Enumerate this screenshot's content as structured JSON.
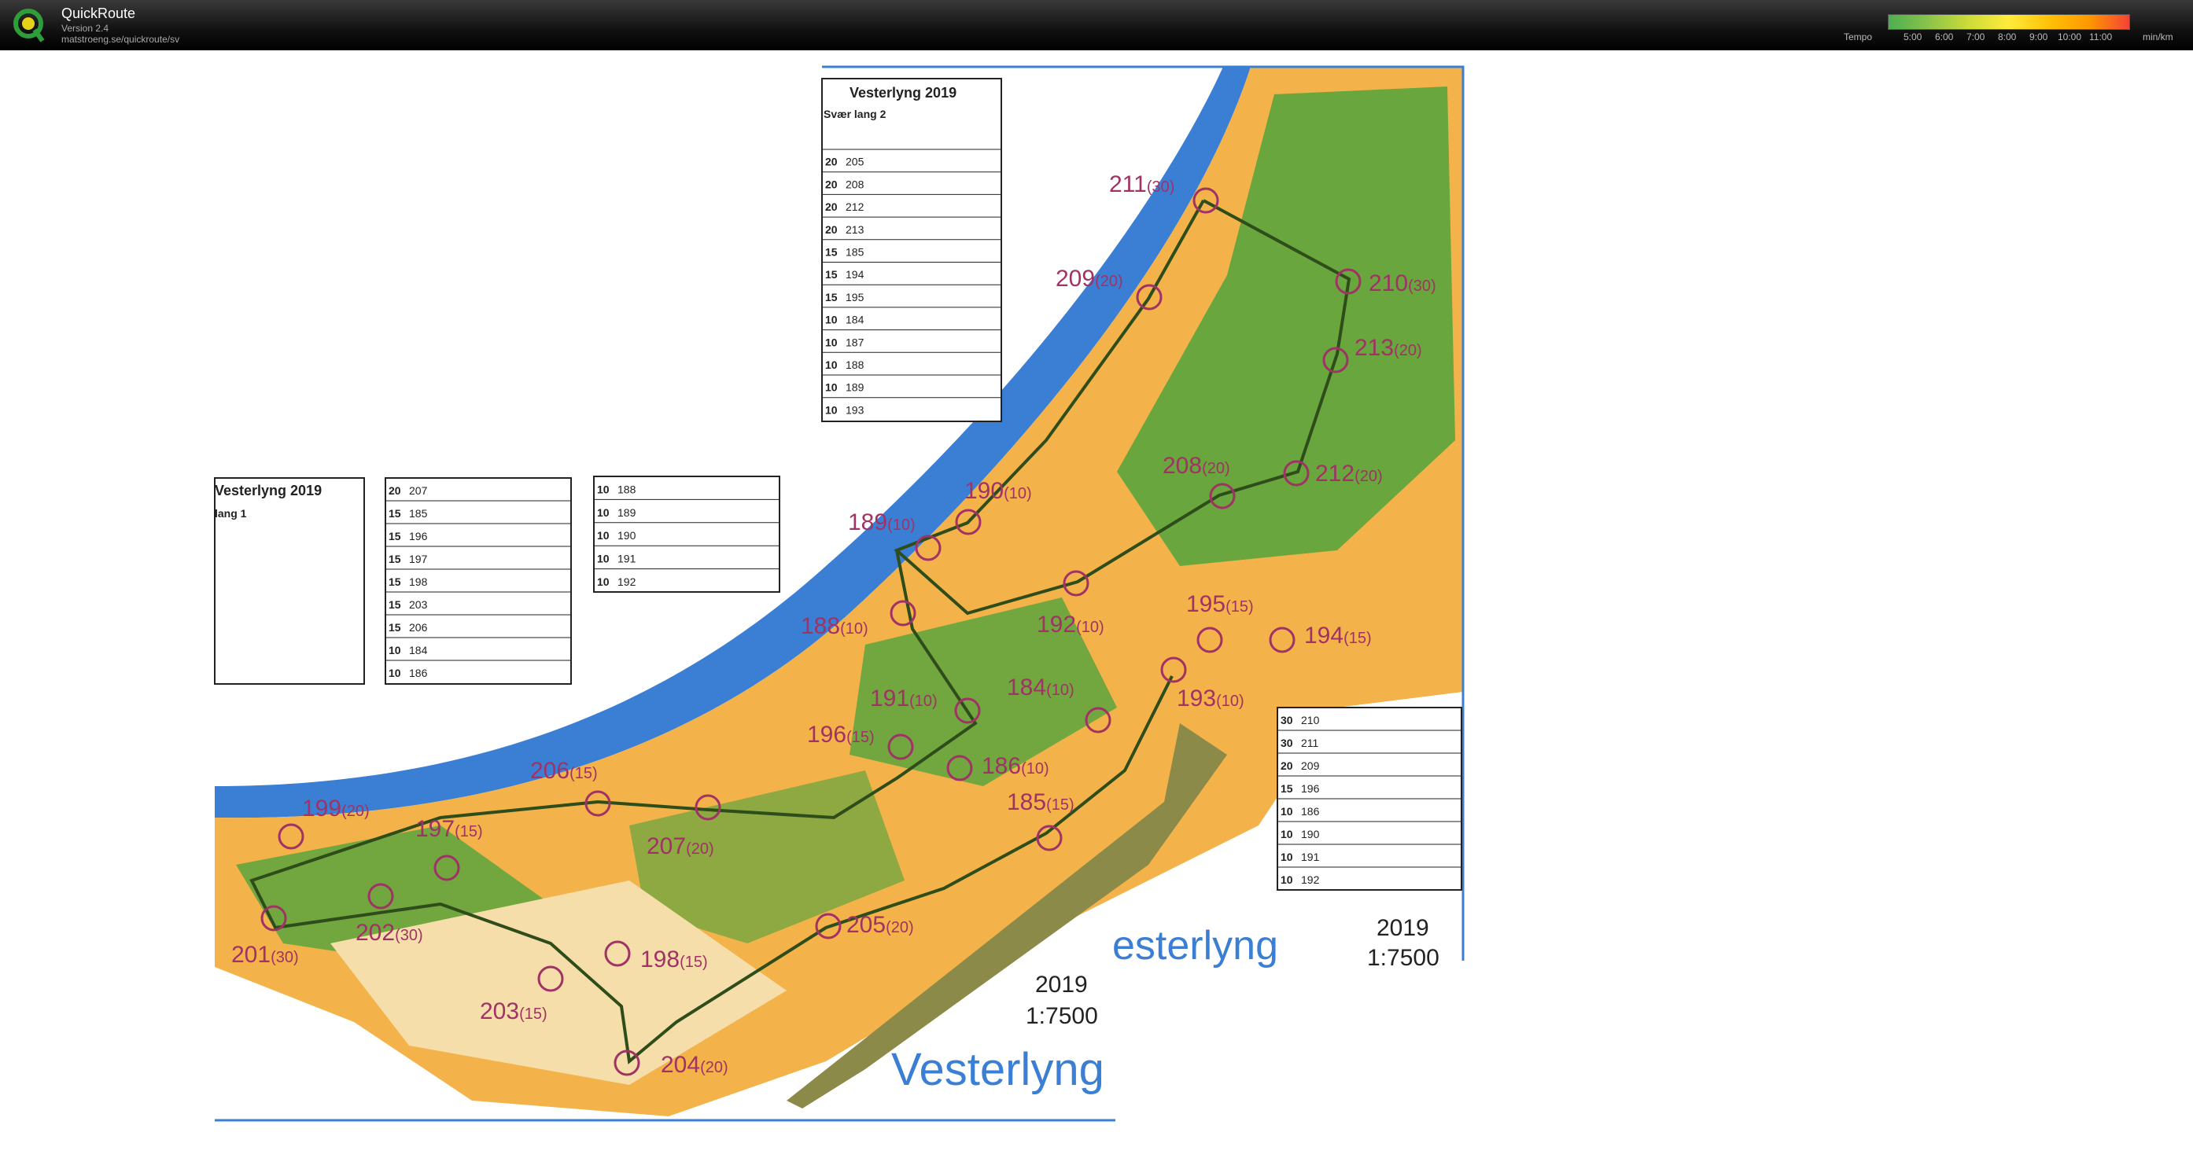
{
  "app": {
    "name": "QuickRoute",
    "version": "Version 2.4",
    "url": "matstroeng.se/quickroute/sv"
  },
  "tempo": {
    "label": "Tempo",
    "ticks": [
      "5:00",
      "6:00",
      "7:00",
      "8:00",
      "9:00",
      "10:00",
      "11:00"
    ],
    "unit": "min/km",
    "colors": [
      "#4caf50",
      "#8bc34a",
      "#cddc39",
      "#ffeb3b",
      "#ffc107",
      "#ff9800",
      "#f44336"
    ]
  },
  "map": {
    "title_main": "Vesterlyng 2019",
    "title_course2": "Svær lang 2",
    "title_course1": "lang 1",
    "year": "2019",
    "scale": "1:7500",
    "place": "Vesterlyng",
    "place_partial": "esterlyng",
    "controls": [
      {
        "num": "211",
        "pts": "(30)"
      },
      {
        "num": "209",
        "pts": "(20)"
      },
      {
        "num": "210",
        "pts": "(30)"
      },
      {
        "num": "213",
        "pts": "(20)"
      },
      {
        "num": "208",
        "pts": "(20)"
      },
      {
        "num": "212",
        "pts": "(20)"
      },
      {
        "num": "190",
        "pts": "(10)"
      },
      {
        "num": "189",
        "pts": "(10)"
      },
      {
        "num": "188",
        "pts": "(10)"
      },
      {
        "num": "192",
        "pts": "(10)"
      },
      {
        "num": "195",
        "pts": "(15)"
      },
      {
        "num": "194",
        "pts": "(15)"
      },
      {
        "num": "193",
        "pts": "(10)"
      },
      {
        "num": "191",
        "pts": "(10)"
      },
      {
        "num": "184",
        "pts": "(10)"
      },
      {
        "num": "196",
        "pts": "(15)"
      },
      {
        "num": "186",
        "pts": "(10)"
      },
      {
        "num": "185",
        "pts": "(15)"
      },
      {
        "num": "206",
        "pts": "(15)"
      },
      {
        "num": "199",
        "pts": "(20)"
      },
      {
        "num": "197",
        "pts": "(15)"
      },
      {
        "num": "207",
        "pts": "(20)"
      },
      {
        "num": "202",
        "pts": "(30)"
      },
      {
        "num": "201",
        "pts": "(30)"
      },
      {
        "num": "205",
        "pts": "(20)"
      },
      {
        "num": "198",
        "pts": "(15)"
      },
      {
        "num": "203",
        "pts": "(15)"
      },
      {
        "num": "204",
        "pts": "(20)"
      }
    ],
    "desc_top": [
      [
        "20",
        "205"
      ],
      [
        "20",
        "208"
      ],
      [
        "20",
        "212"
      ],
      [
        "20",
        "213"
      ],
      [
        "15",
        "185"
      ],
      [
        "15",
        "194"
      ],
      [
        "15",
        "195"
      ],
      [
        "10",
        "184"
      ],
      [
        "10",
        "187"
      ],
      [
        "10",
        "188"
      ],
      [
        "10",
        "189"
      ],
      [
        "10",
        "193"
      ]
    ],
    "desc_mid": [
      [
        "20",
        "207"
      ],
      [
        "15",
        "185"
      ],
      [
        "15",
        "196"
      ],
      [
        "15",
        "197"
      ],
      [
        "15",
        "198"
      ],
      [
        "15",
        "203"
      ],
      [
        "15",
        "206"
      ],
      [
        "10",
        "184"
      ],
      [
        "10",
        "186"
      ]
    ],
    "desc_small": [
      [
        "10",
        "188"
      ],
      [
        "10",
        "189"
      ],
      [
        "10",
        "190"
      ],
      [
        "10",
        "191"
      ],
      [
        "10",
        "192"
      ]
    ],
    "desc_right": [
      [
        "30",
        "210"
      ],
      [
        "30",
        "211"
      ],
      [
        "20",
        "209"
      ],
      [
        "15",
        "196"
      ],
      [
        "10",
        "186"
      ],
      [
        "10",
        "190"
      ],
      [
        "10",
        "191"
      ],
      [
        "10",
        "192"
      ]
    ]
  }
}
